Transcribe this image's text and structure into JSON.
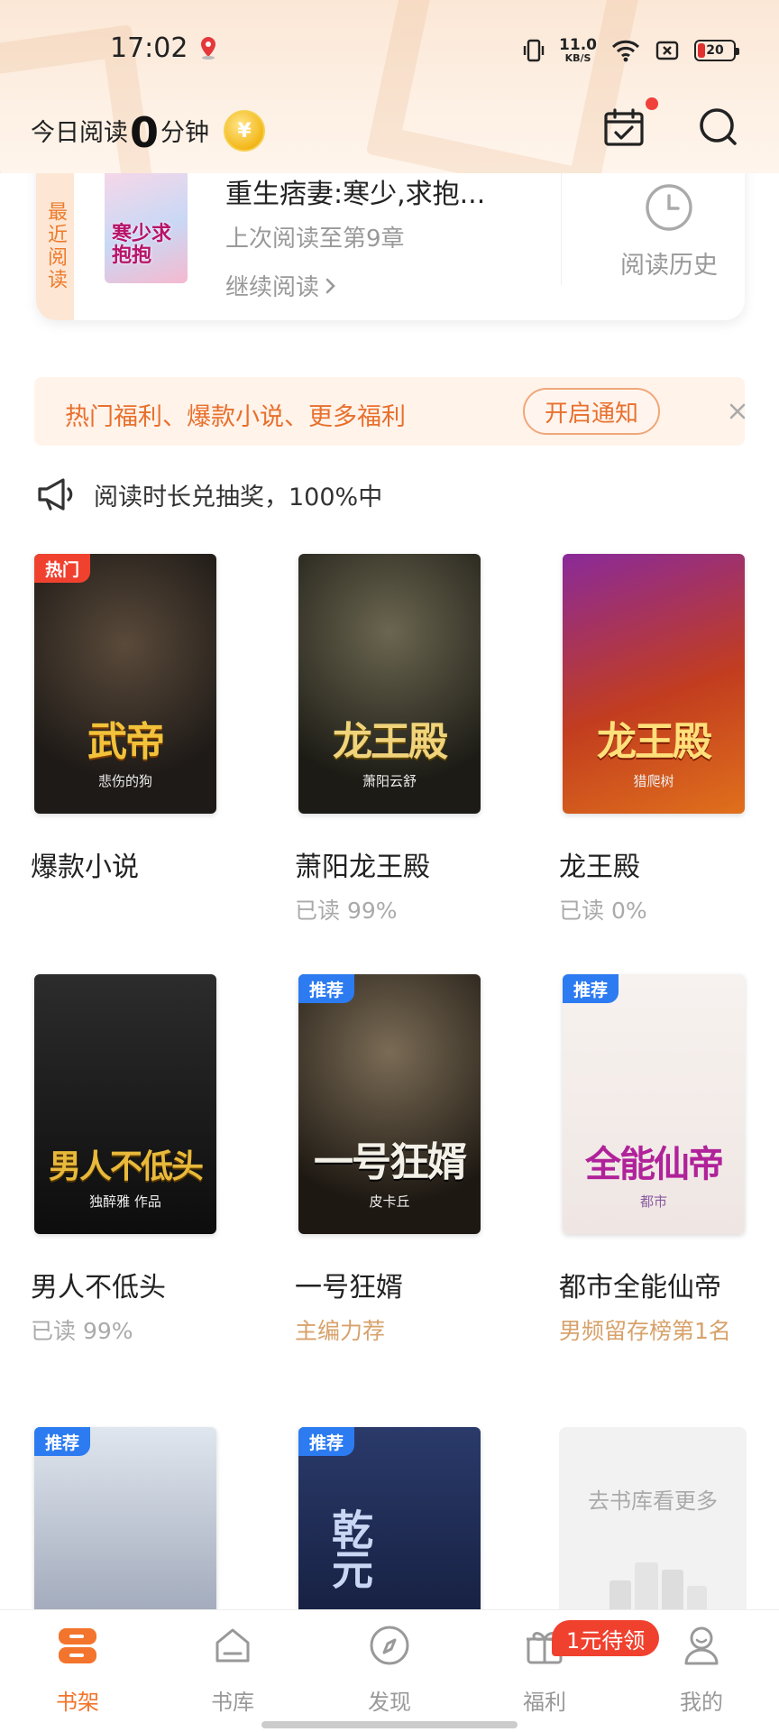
{
  "status_bar": {
    "time": "17:02",
    "net_speed": "11.0",
    "net_unit": "KB/S",
    "battery": "20"
  },
  "header": {
    "reading_prefix": "今日阅读",
    "reading_minutes": "0",
    "reading_suffix": "分钟"
  },
  "recent": {
    "tag": "最近阅读",
    "cover_text": "寒少求抱抱",
    "title": "重生痞妻:寒少,求抱...",
    "progress": "上次阅读至第9章",
    "continue_label": "继续阅读",
    "history_label": "阅读历史"
  },
  "notify": {
    "text": "热门福利、爆款小说、更多福利",
    "button": "开启通知"
  },
  "announce": {
    "text": "阅读时长兑抽奖，100%中"
  },
  "books": [
    {
      "name": "爆款小说",
      "meta": "",
      "badge": "热门",
      "cover_title": "武帝",
      "cover_author": "悲伤的狗"
    },
    {
      "name": "萧阳龙王殿",
      "meta": "已读 99%",
      "badge": "",
      "cover_title": "龙王殿",
      "cover_author": "萧阳云舒"
    },
    {
      "name": "龙王殿",
      "meta": "已读 0%",
      "badge": "",
      "cover_title": "龙王殿",
      "cover_author": "猎爬树"
    },
    {
      "name": "男人不低头",
      "meta": "已读 99%",
      "badge": "",
      "cover_title": "男人不低头",
      "cover_author": "独醉雅 作品"
    },
    {
      "name": "一号狂婿",
      "meta": "主编力荐",
      "badge": "推荐",
      "cover_title": "一号狂婿",
      "cover_author": "皮卡丘"
    },
    {
      "name": "都市全能仙帝",
      "meta": "男频留存榜第1名",
      "badge": "推荐",
      "cover_title": "全能仙帝",
      "cover_author": "都市"
    },
    {
      "name": "",
      "meta": "",
      "badge": "推荐",
      "cover_title": "",
      "cover_author": ""
    },
    {
      "name": "",
      "meta": "",
      "badge": "推荐",
      "cover_title": "乾元",
      "cover_author": ""
    }
  ],
  "more": {
    "label": "去书库看更多"
  },
  "nav": {
    "items": [
      {
        "label": "书架",
        "icon": "bookshelf-icon"
      },
      {
        "label": "书库",
        "icon": "library-icon"
      },
      {
        "label": "发现",
        "icon": "compass-icon"
      },
      {
        "label": "福利",
        "icon": "gift-icon"
      },
      {
        "label": "我的",
        "icon": "profile-icon"
      }
    ],
    "welfare_badge": "1元待领"
  },
  "colors": {
    "accent": "#f3742c",
    "hot_badge": "#f0412f",
    "rec_badge": "#2c7bf1"
  }
}
